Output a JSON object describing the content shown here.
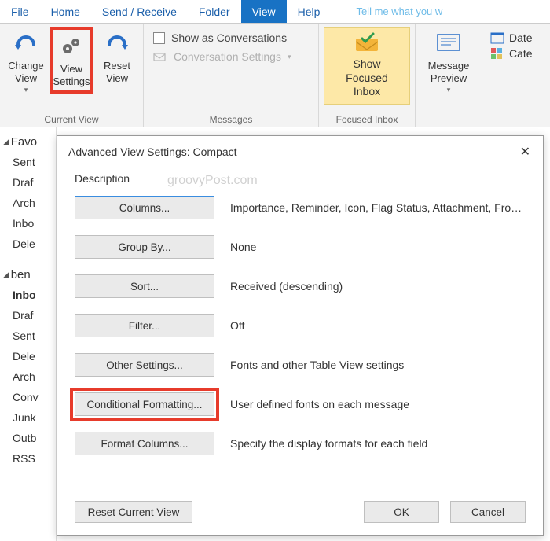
{
  "menubar": {
    "tabs": [
      "File",
      "Home",
      "Send / Receive",
      "Folder",
      "View",
      "Help"
    ],
    "active_index": 4,
    "tell_me": "Tell me what you w"
  },
  "ribbon": {
    "current_view": {
      "label": "Current View",
      "change_view": "Change View",
      "view_settings": "View Settings",
      "reset_view": "Reset View"
    },
    "messages": {
      "label": "Messages",
      "show_conversations": "Show as Conversations",
      "conversation_settings": "Conversation Settings"
    },
    "focused_inbox": {
      "label": "Focused Inbox",
      "button": "Show Focused Inbox"
    },
    "message_preview": "Message Preview",
    "arrangement": {
      "date": "Date",
      "cate": "Cate"
    }
  },
  "folder_pane": {
    "favorites_header": "Favo",
    "favorites": [
      "Sent",
      "Draf",
      "Arch",
      "Inbo",
      "Dele"
    ],
    "account_header": "ben",
    "account_folders": [
      "Inbo",
      "Draf",
      "Sent",
      "Dele",
      "Arch",
      "Conv",
      "Junk",
      "Outb",
      "RSS"
    ],
    "bold_index": 0
  },
  "dialog": {
    "title": "Advanced View Settings: Compact",
    "description_label": "Description",
    "watermark": "groovyPost.com",
    "rows": [
      {
        "button": "Columns...",
        "value": "Importance, Reminder, Icon, Flag Status, Attachment, From, Su..."
      },
      {
        "button": "Group By...",
        "value": "None"
      },
      {
        "button": "Sort...",
        "value": "Received (descending)"
      },
      {
        "button": "Filter...",
        "value": "Off"
      },
      {
        "button": "Other Settings...",
        "value": "Fonts and other Table View settings"
      },
      {
        "button": "Conditional Formatting...",
        "value": "User defined fonts on each message"
      },
      {
        "button": "Format Columns...",
        "value": "Specify the display formats for each field"
      }
    ],
    "reset": "Reset Current View",
    "ok": "OK",
    "cancel": "Cancel"
  }
}
